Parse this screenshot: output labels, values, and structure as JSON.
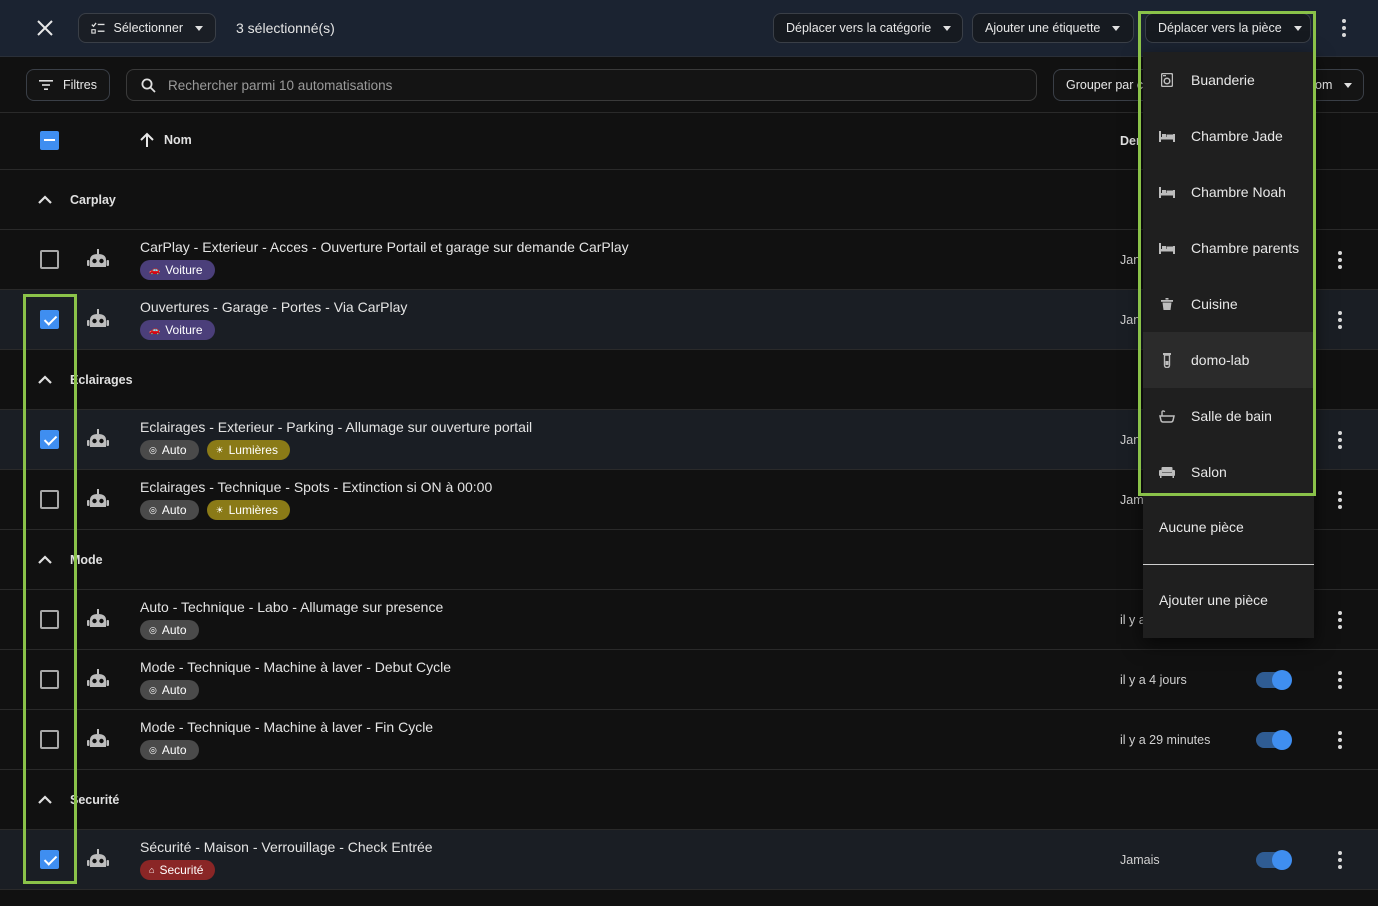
{
  "toolbar": {
    "select_label": "Sélectionner",
    "selected_count": "3 sélectionné(s)",
    "move_category_label": "Déplacer vers la catégorie",
    "add_label_label": "Ajouter une étiquette",
    "move_room_label": "Déplacer vers la pièce"
  },
  "filters": {
    "filters_label": "Filtres",
    "search_placeholder": "Rechercher parmi 10 automatisations",
    "group_by_label": "Grouper par c",
    "sort_partial": "om"
  },
  "table": {
    "name_header": "Nom",
    "date_header_partial": "Der"
  },
  "groups": [
    {
      "label": "Carplay",
      "rows": [
        {
          "title": "CarPlay - Exterieur - Acces - Ouverture Portail et garage sur demande CarPlay",
          "tags": [
            {
              "label": "Voiture",
              "kind": "voiture"
            }
          ],
          "date": "Jan",
          "selected": false,
          "enabled": null
        },
        {
          "title": "Ouvertures - Garage - Portes - Via CarPlay",
          "tags": [
            {
              "label": "Voiture",
              "kind": "voiture"
            }
          ],
          "date": "Jan",
          "selected": true,
          "enabled": null
        }
      ]
    },
    {
      "label": "Eclairages",
      "rows": [
        {
          "title": "Eclairages - Exterieur - Parking - Allumage sur ouverture portail",
          "tags": [
            {
              "label": "Auto",
              "kind": "auto"
            },
            {
              "label": "Lumières",
              "kind": "lum"
            }
          ],
          "date": "Jan",
          "selected": true,
          "enabled": null
        },
        {
          "title": "Eclairages - Technique - Spots - Extinction si ON à 00:00",
          "tags": [
            {
              "label": "Auto",
              "kind": "auto"
            },
            {
              "label": "Lumières",
              "kind": "lum"
            }
          ],
          "date": "Jam",
          "selected": false,
          "enabled": null
        }
      ]
    },
    {
      "label": "Mode",
      "rows": [
        {
          "title": "Auto - Technique - Labo - Allumage sur presence",
          "tags": [
            {
              "label": "Auto",
              "kind": "auto"
            }
          ],
          "date": "il y a",
          "selected": false,
          "enabled": null
        },
        {
          "title": "Mode - Technique - Machine à laver - Debut Cycle",
          "tags": [
            {
              "label": "Auto",
              "kind": "auto"
            }
          ],
          "date": "il y a 4 jours",
          "selected": false,
          "enabled": true
        },
        {
          "title": "Mode - Technique - Machine à laver - Fin Cycle",
          "tags": [
            {
              "label": "Auto",
              "kind": "auto"
            }
          ],
          "date": "il y a 29 minutes",
          "selected": false,
          "enabled": true
        }
      ]
    },
    {
      "label": "Securité",
      "rows": [
        {
          "title": "Sécurité - Maison - Verrouillage - Check Entrée",
          "tags": [
            {
              "label": "Securité",
              "kind": "secu"
            }
          ],
          "date": "Jamais",
          "selected": true,
          "enabled": true
        }
      ]
    }
  ],
  "room_menu": {
    "items": [
      {
        "label": "Buanderie",
        "icon": "washing-machine-icon"
      },
      {
        "label": "Chambre Jade",
        "icon": "bed-icon"
      },
      {
        "label": "Chambre Noah",
        "icon": "bed-icon"
      },
      {
        "label": "Chambre parents",
        "icon": "bed-icon"
      },
      {
        "label": "Cuisine",
        "icon": "pot-icon"
      },
      {
        "label": "domo-lab",
        "icon": "test-tube-icon"
      },
      {
        "label": "Salle de bain",
        "icon": "bathtub-icon"
      },
      {
        "label": "Salon",
        "icon": "sofa-icon"
      }
    ],
    "no_room_label": "Aucune pièce",
    "add_room_label": "Ajouter une pièce",
    "highlighted_index": 5
  },
  "colors": {
    "accent": "#3f8ef0",
    "highlight_box": "#8ac249",
    "tag_voiture": "#4b3f7a",
    "tag_auto": "#4a4a4a",
    "tag_lumieres": "#8a7a17",
    "tag_securite": "#8a2626"
  }
}
